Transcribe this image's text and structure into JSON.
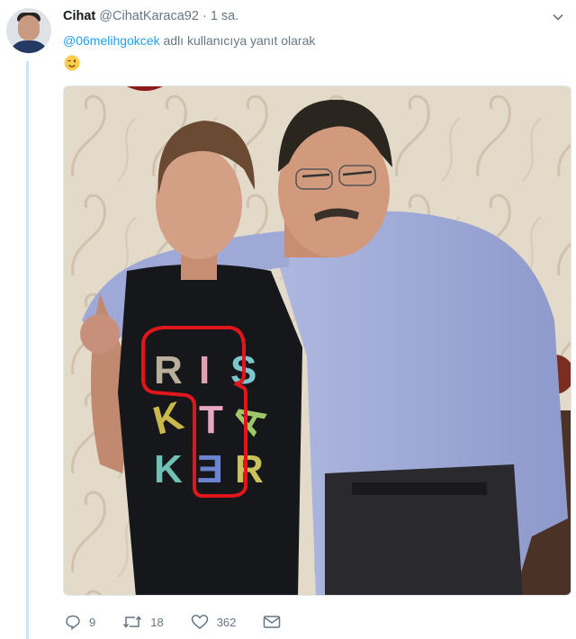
{
  "tweet": {
    "display_name": "Cihat",
    "handle": "@CihatKaraca92",
    "separator": "·",
    "time": "1 sa.",
    "reply_mention": "@06melihgokcek",
    "reply_suffix": " adlı kullanıcıya yanıt olarak",
    "emoji": "wink-face"
  },
  "photo": {
    "shirt_letters": [
      "R",
      "I",
      "S",
      "K",
      "T",
      "A",
      "K",
      "E",
      "R"
    ]
  },
  "actions": {
    "replies": "9",
    "retweets": "18",
    "likes": "362"
  },
  "colors": {
    "link": "#1da1f2",
    "muted": "#657786",
    "thread_line": "#c9e6f8",
    "highlight_red": "#e0161c"
  }
}
